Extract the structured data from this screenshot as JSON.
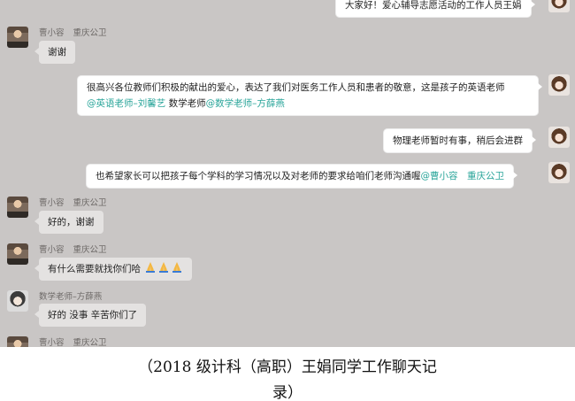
{
  "messages": [
    {
      "id": "m0",
      "dir": "out",
      "text": "大家好！爱心辅导志愿活动的工作人员王娟"
    },
    {
      "id": "m1",
      "dir": "in",
      "sender": "曹小容",
      "role": "重庆公卫",
      "text": "谢谢"
    },
    {
      "id": "m2",
      "dir": "out",
      "line1": "很高兴各位教师们积极的献出的爱心，表达了我们对医务工作人员和患者的敬意，这是孩子的英语老师",
      "mention1": "@英语老师–刘馨艺",
      "mid": " 数学老师",
      "mention2": "@数学老师–方薛燕"
    },
    {
      "id": "m3",
      "dir": "out",
      "text": "物理老师暂时有事，稍后会进群"
    },
    {
      "id": "m4",
      "dir": "out",
      "text": "也希望家长可以把孩子每个学科的学习情况以及对老师的要求给咱们老师沟通喔",
      "mention": "@曹小容　重庆公卫"
    },
    {
      "id": "m5",
      "dir": "in",
      "sender": "曹小容",
      "role": "重庆公卫",
      "text": "好的，谢谢"
    },
    {
      "id": "m6",
      "dir": "in",
      "sender": "曹小容",
      "role": "重庆公卫",
      "text": "有什么需要就找你们哈"
    },
    {
      "id": "m7",
      "dir": "in",
      "sender": "数学老师–方薛燕",
      "role": "",
      "text": "好的  没事  辛苦你们了"
    },
    {
      "id": "m8",
      "dir": "in",
      "sender": "曹小容",
      "role": "重庆公卫",
      "text": ""
    }
  ],
  "caption": {
    "line1": "（2018 级计科（高职）王娟同学工作聊天记",
    "line2": "录）"
  },
  "colors": {
    "chat_bg": "#c9c6c5",
    "mention": "#2aa59a",
    "bubble_in": "#e4e2e1",
    "bubble_out": "#ffffff"
  },
  "icons": {
    "emoji": "folded-hands-emoji"
  }
}
